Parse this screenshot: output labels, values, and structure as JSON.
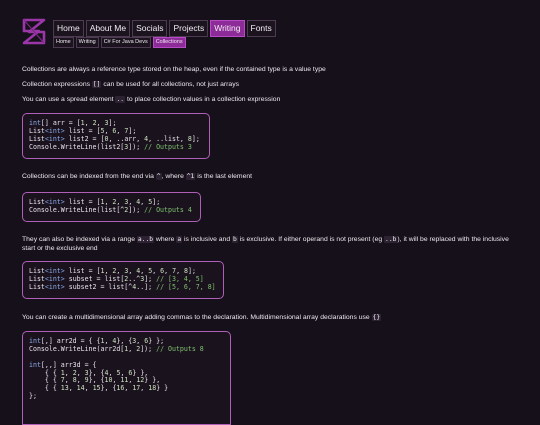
{
  "nav": {
    "items": [
      "Home",
      "About Me",
      "Socials",
      "Projects",
      "Writing",
      "Fonts"
    ],
    "active": "Writing"
  },
  "breadcrumb": [
    "Home",
    "Writing",
    "C# For Java Devs",
    "Collections"
  ],
  "paragraphs": {
    "p1": "Collections are always a reference type stored on the heap, even if the contained type is a value type",
    "p2_before": "Collection expressions ",
    "p2_code": "[]",
    "p2_after": " can be used for all collections, not just arrays",
    "p3_before": "You can use a spread element ",
    "p3_code": "..",
    "p3_after": " to place collection values in a collection expression",
    "p4_before": "Collections can be indexed from the end via ",
    "p4_code1": "^",
    "p4_mid": ", where ",
    "p4_code2": "^1",
    "p4_after": " is the last element",
    "p5_before": "They can also be indexed via a range ",
    "p5_code1": "a..b",
    "p5_mid1": " where ",
    "p5_code2": "a",
    "p5_mid2": " is inclusive and ",
    "p5_code3": "b",
    "p5_mid3": " is exclusive. If either operand is not present (eg ",
    "p5_code4": "..b",
    "p5_after": "), it will be replaced with the inclusive start or the exclusive end",
    "p6_before": "You can create a multidimensional array adding commas to the declaration. Multidimensional array declarations use ",
    "p6_code": "{}"
  },
  "code_blocks": [
    {
      "lines": [
        [
          [
            "int",
            "kw"
          ],
          [
            "[] arr = [",
            ""
          ],
          [
            "1",
            "num"
          ],
          [
            ", ",
            ""
          ],
          [
            "2",
            "num"
          ],
          [
            ", ",
            ""
          ],
          [
            "3",
            "num"
          ],
          [
            "];",
            ""
          ]
        ],
        [
          [
            "List",
            ""
          ],
          [
            "<int>",
            "kw"
          ],
          [
            " list = [",
            ""
          ],
          [
            "5",
            "num"
          ],
          [
            ", ",
            ""
          ],
          [
            "6",
            "num"
          ],
          [
            ", ",
            ""
          ],
          [
            "7",
            "num"
          ],
          [
            "];",
            ""
          ]
        ],
        [
          [
            "List",
            ""
          ],
          [
            "<int>",
            "kw"
          ],
          [
            " list2 = [",
            ""
          ],
          [
            "0",
            "num"
          ],
          [
            ", ..arr, ",
            ""
          ],
          [
            "4",
            "num"
          ],
          [
            ", ..list, ",
            ""
          ],
          [
            "8",
            "num"
          ],
          [
            "];",
            ""
          ]
        ],
        [
          [
            "Console.WriteLine(list2[",
            ""
          ],
          [
            "3",
            "num"
          ],
          [
            "]); ",
            ""
          ],
          [
            "// Outputs 3",
            "cmt"
          ]
        ]
      ]
    },
    {
      "lines": [
        [
          [
            "List",
            ""
          ],
          [
            "<int>",
            "kw"
          ],
          [
            " list = [",
            ""
          ],
          [
            "1",
            "num"
          ],
          [
            ", ",
            ""
          ],
          [
            "2",
            "num"
          ],
          [
            ", ",
            ""
          ],
          [
            "3",
            "num"
          ],
          [
            ", ",
            ""
          ],
          [
            "4",
            "num"
          ],
          [
            ", ",
            ""
          ],
          [
            "5",
            "num"
          ],
          [
            "];",
            ""
          ]
        ],
        [
          [
            "Console.WriteLine(list[^",
            ""
          ],
          [
            "2",
            "num"
          ],
          [
            "]); ",
            ""
          ],
          [
            "// Outputs 4",
            "cmt"
          ]
        ]
      ]
    },
    {
      "lines": [
        [
          [
            "List",
            ""
          ],
          [
            "<int>",
            "kw"
          ],
          [
            " list = [",
            ""
          ],
          [
            "1",
            "num"
          ],
          [
            ", ",
            ""
          ],
          [
            "2",
            "num"
          ],
          [
            ", ",
            ""
          ],
          [
            "3",
            "num"
          ],
          [
            ", ",
            ""
          ],
          [
            "4",
            "num"
          ],
          [
            ", ",
            ""
          ],
          [
            "5",
            "num"
          ],
          [
            ", ",
            ""
          ],
          [
            "6",
            "num"
          ],
          [
            ", ",
            ""
          ],
          [
            "7",
            "num"
          ],
          [
            ", ",
            ""
          ],
          [
            "8",
            "num"
          ],
          [
            "];",
            ""
          ]
        ],
        [
          [
            "List",
            ""
          ],
          [
            "<int>",
            "kw"
          ],
          [
            " subset = list[",
            ""
          ],
          [
            "2",
            "num"
          ],
          [
            "..^",
            ""
          ],
          [
            "3",
            "num"
          ],
          [
            "]; ",
            ""
          ],
          [
            "// [3, 4, 5]",
            "cmt"
          ]
        ],
        [
          [
            "List",
            ""
          ],
          [
            "<int>",
            "kw"
          ],
          [
            " subset2 = list[^",
            ""
          ],
          [
            "4",
            "num"
          ],
          [
            "..]; ",
            ""
          ],
          [
            "// [5, 6, 7, 8]",
            "cmt"
          ]
        ]
      ]
    },
    {
      "lines": [
        [
          [
            "int",
            "kw"
          ],
          [
            "[,] arr2d = { {",
            ""
          ],
          [
            "1",
            "num"
          ],
          [
            ", ",
            ""
          ],
          [
            "4",
            "num"
          ],
          [
            "}, {",
            ""
          ],
          [
            "3",
            "num"
          ],
          [
            ", ",
            ""
          ],
          [
            "6",
            "num"
          ],
          [
            "} };",
            ""
          ]
        ],
        [
          [
            "Console.WriteLine(arr2d[",
            ""
          ],
          [
            "1",
            "num"
          ],
          [
            ", ",
            ""
          ],
          [
            "2",
            "num"
          ],
          [
            "]); ",
            ""
          ],
          [
            "// Outputs 8",
            "cmt"
          ]
        ],
        [
          [
            "",
            ""
          ]
        ],
        [
          [
            "int",
            "kw"
          ],
          [
            "[,,] arr3d = {",
            ""
          ]
        ],
        [
          [
            "    { { ",
            ""
          ],
          [
            "1",
            "num"
          ],
          [
            ", ",
            ""
          ],
          [
            "2",
            "num"
          ],
          [
            ", ",
            ""
          ],
          [
            "3",
            "num"
          ],
          [
            "}, {",
            ""
          ],
          [
            "4",
            "num"
          ],
          [
            ", ",
            ""
          ],
          [
            "5",
            "num"
          ],
          [
            ", ",
            ""
          ],
          [
            "6",
            "num"
          ],
          [
            "} },",
            ""
          ]
        ],
        [
          [
            "    { { ",
            ""
          ],
          [
            "7",
            "num"
          ],
          [
            ", ",
            ""
          ],
          [
            "8",
            "num"
          ],
          [
            ", ",
            ""
          ],
          [
            "9",
            "num"
          ],
          [
            "}, {",
            ""
          ],
          [
            "10",
            "num"
          ],
          [
            ", ",
            ""
          ],
          [
            "11",
            "num"
          ],
          [
            ", ",
            ""
          ],
          [
            "12",
            "num"
          ],
          [
            "} },",
            ""
          ]
        ],
        [
          [
            "    { { ",
            ""
          ],
          [
            "13",
            "num"
          ],
          [
            ", ",
            ""
          ],
          [
            "14",
            "num"
          ],
          [
            ", ",
            ""
          ],
          [
            "15",
            "num"
          ],
          [
            "}, {",
            ""
          ],
          [
            "16",
            "num"
          ],
          [
            ", ",
            ""
          ],
          [
            "17",
            "num"
          ],
          [
            ", ",
            ""
          ],
          [
            "18",
            "num"
          ],
          [
            "} }",
            ""
          ]
        ],
        [
          [
            "};",
            ""
          ]
        ]
      ]
    }
  ]
}
